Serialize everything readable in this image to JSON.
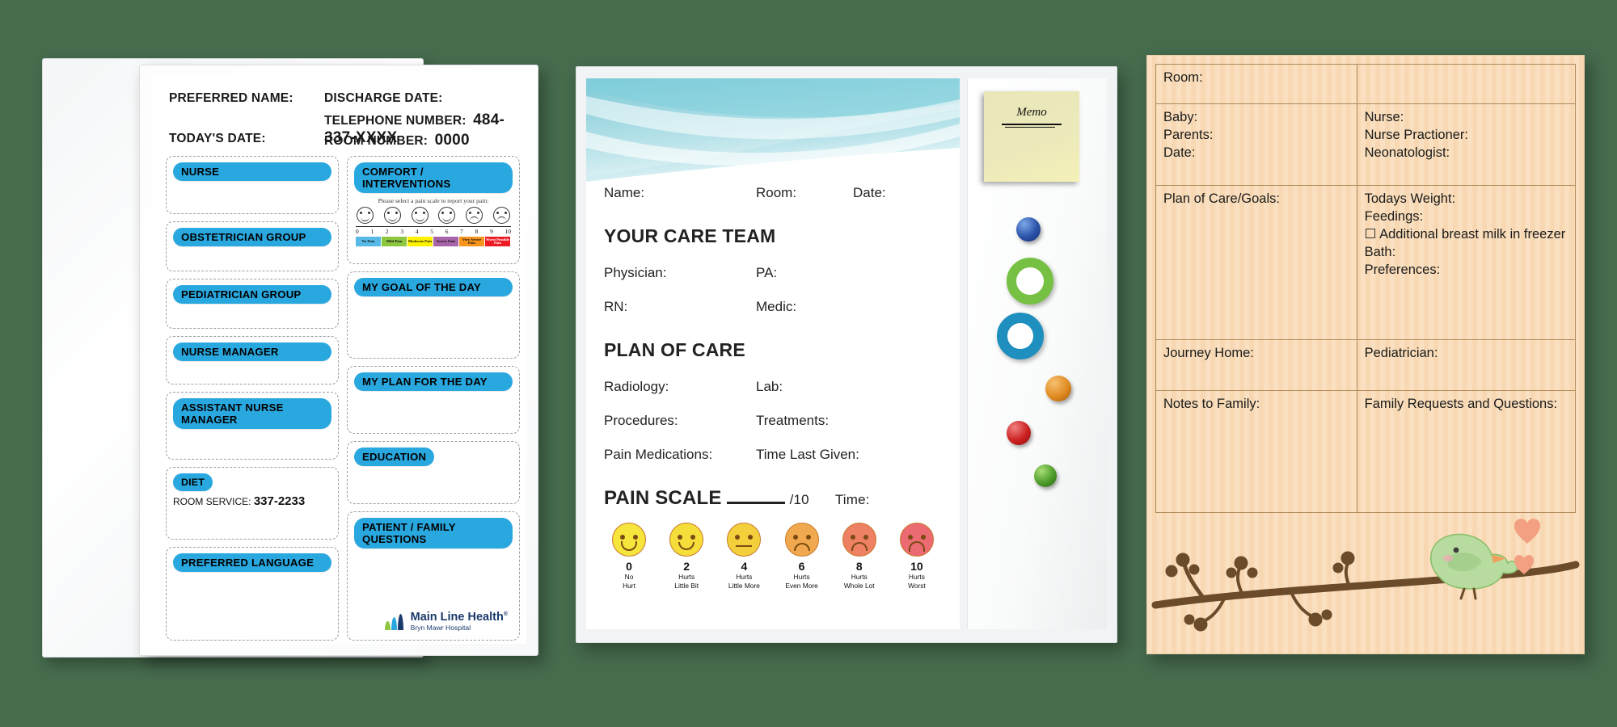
{
  "scene": {
    "background_color": "#466b4d",
    "description": "Three hospital patient communication whiteboards displayed side by side"
  },
  "board1": {
    "name": "maternity-patient-whiteboard",
    "header": {
      "preferred_name_label": "PREFERRED NAME:",
      "todays_date_label": "TODAY'S DATE:",
      "discharge_date_label": "DISCHARGE DATE:",
      "telephone_label": "TELEPHONE NUMBER:",
      "telephone_value": "484-337-XXXX",
      "room_label": "ROOM NUMBER:",
      "room_value": "0000"
    },
    "left_column": [
      {
        "label": "NURSE"
      },
      {
        "label": "OBSTETRICIAN GROUP"
      },
      {
        "label": "PEDIATRICIAN GROUP"
      },
      {
        "label": "NURSE MANAGER"
      },
      {
        "label": "ASSISTANT NURSE MANAGER"
      },
      {
        "label": "DIET",
        "sub_label": "ROOM SERVICE:",
        "sub_value": "337-2233"
      },
      {
        "label": "PREFERRED LANGUAGE"
      }
    ],
    "right_column": [
      {
        "label": "COMFORT / INTERVENTIONS"
      },
      {
        "label": "MY GOAL OF THE DAY"
      },
      {
        "label": "MY PLAN FOR THE DAY"
      },
      {
        "label": "EDUCATION"
      },
      {
        "label": "PATIENT / FAMILY QUESTIONS"
      }
    ],
    "pain_scale": {
      "instruction": "Please select a pain scale to report your pain:",
      "numbers": [
        "0",
        "1",
        "2",
        "3",
        "4",
        "5",
        "6",
        "7",
        "8",
        "9",
        "10"
      ],
      "segments": [
        {
          "label": "No Pain",
          "color": "#57b9e6"
        },
        {
          "label": "Mild Pain",
          "color": "#8dc63f"
        },
        {
          "label": "Moderate Pain",
          "color": "#fff200"
        },
        {
          "label": "Severe Pain",
          "color": "#a864a8"
        },
        {
          "label": "Very Severe Pain",
          "color": "#f7941e"
        },
        {
          "label": "Worst Possible Pain",
          "color": "#ed1c24"
        }
      ]
    },
    "logo": {
      "title": "Main Line Health",
      "trademark": "®",
      "subtitle": "Bryn Mawr Hospital",
      "color": "#1a3a6b"
    }
  },
  "board2": {
    "name": "care-team-plan-of-care-whiteboard",
    "top_fields": [
      {
        "label": "Name:"
      },
      {
        "label": "Room:"
      },
      {
        "label": "Date:"
      }
    ],
    "care_team_heading": "YOUR CARE TEAM",
    "care_team_fields": [
      {
        "label": "Physician:"
      },
      {
        "label": "PA:"
      },
      {
        "label": "RN:"
      },
      {
        "label": "Medic:"
      }
    ],
    "plan_heading": "PLAN OF CARE",
    "plan_fields": [
      {
        "label": "Radiology:"
      },
      {
        "label": "Lab:"
      },
      {
        "label": "Procedures:"
      },
      {
        "label": "Treatments:"
      },
      {
        "label": "Pain Medications:"
      },
      {
        "label": "Time Last Given:"
      }
    ],
    "pain_scale": {
      "heading": "PAIN SCALE",
      "out_of": "/10",
      "time_label": "Time:",
      "faces": [
        {
          "number": "0",
          "line1": "No",
          "line2": "Hurt",
          "color": "#f6e53c"
        },
        {
          "number": "2",
          "line1": "Hurts",
          "line2": "Little Bit",
          "color": "#f5dd3a"
        },
        {
          "number": "4",
          "line1": "Hurts",
          "line2": "Little More",
          "color": "#f3cf3c"
        },
        {
          "number": "6",
          "line1": "Hurts",
          "line2": "Even More",
          "color": "#f0a94e"
        },
        {
          "number": "8",
          "line1": "Hurts",
          "line2": "Whole Lot",
          "color": "#ee8063"
        },
        {
          "number": "10",
          "line1": "Hurts",
          "line2": "Worst",
          "color": "#ec6a72"
        }
      ]
    },
    "memo": {
      "title": "Memo"
    },
    "magnets": [
      {
        "name": "blue-dome-magnet",
        "color": "#2b52a8"
      },
      {
        "name": "green-ring-magnet",
        "color": "#76c043"
      },
      {
        "name": "blue-ring-magnet",
        "color": "#1e8fbe"
      },
      {
        "name": "orange-dome-magnet",
        "color": "#e08b22"
      },
      {
        "name": "red-dome-magnet",
        "color": "#cc2020"
      },
      {
        "name": "green-dome-magnet",
        "color": "#4d9c2a"
      }
    ]
  },
  "board3": {
    "name": "newborn-nursery-whiteboard",
    "rows": [
      {
        "left": [
          "Room:"
        ],
        "right": []
      },
      {
        "left": [
          "Baby:",
          "Parents:",
          "Date:"
        ],
        "right": [
          "Nurse:",
          "Nurse Practioner:",
          "Neonatologist:"
        ]
      },
      {
        "left": [
          "Plan of Care/Goals:"
        ],
        "right": [
          "Todays Weight:",
          "Feedings:",
          "☐ Additional breast milk in freezer",
          "Bath:",
          "Preferences:"
        ]
      },
      {
        "left": [
          "Journey Home:"
        ],
        "right": [
          "Pediatrician:"
        ]
      },
      {
        "left": [
          "Notes to Family:"
        ],
        "right": [
          "Family Requests and Questions:"
        ]
      }
    ],
    "artwork": {
      "name": "bird-on-branch-illustration",
      "bird_color": "#b8dba0",
      "branch_color": "#6b4b2a",
      "heart_color": "#f2a081"
    }
  }
}
